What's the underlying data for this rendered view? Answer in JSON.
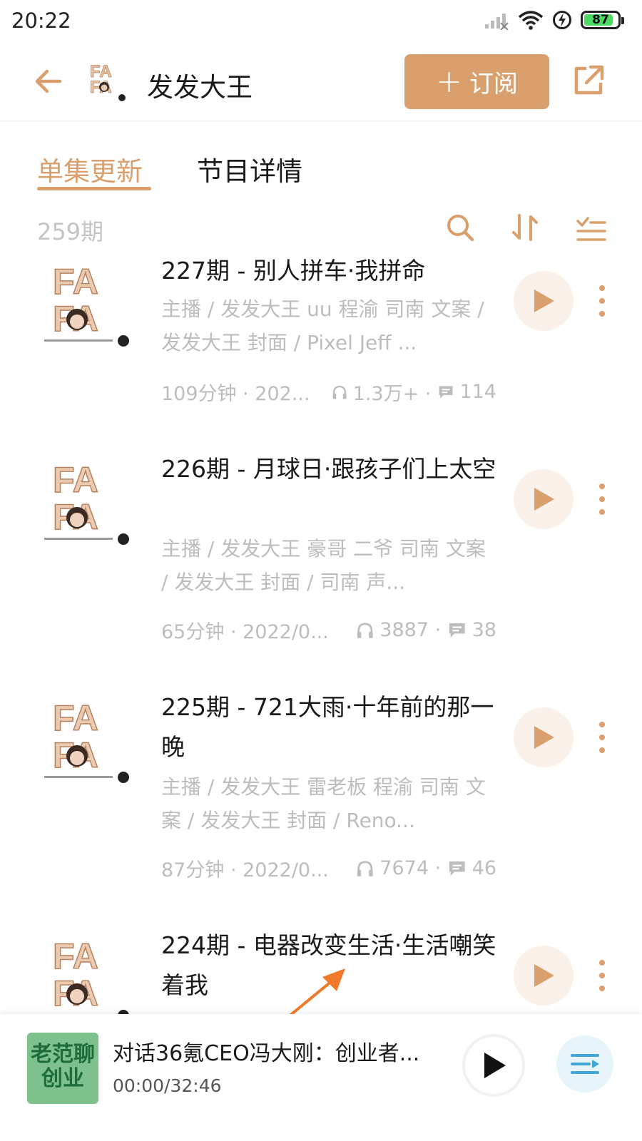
{
  "status_bar": {
    "time": "20:22",
    "battery": "87",
    "battery_level": 0.87
  },
  "header": {
    "podcast_title": "发发大王",
    "subscribe_label": "订阅",
    "icons": [
      "back-arrow-icon",
      "share-icon"
    ]
  },
  "tabs": {
    "active": "单集更新",
    "inactive": "节目详情"
  },
  "toolbar": {
    "episode_count": "259期",
    "icons": [
      "search-icon",
      "sort-icon",
      "filter-list-icon"
    ]
  },
  "episodes": [
    {
      "title": "227期 - 别人拼车·我拼命",
      "desc": "主播 / 发发大王 uu 程渝 司南 文案 / 发发大王 封面 / Pixel Jeff ...",
      "duration_date": "109分钟 · 202...",
      "plays": "1.3万+ ·",
      "comments": "114"
    },
    {
      "title": "226期 - 月球日·跟孩子们上太空",
      "desc": "主播 / 发发大王 豪哥 二爷 司南 文案 / 发发大王 封面 / 司南 声...",
      "duration_date": "65分钟 · 2022/0...",
      "plays": "3887 ·",
      "comments": "38"
    },
    {
      "title": "225期 - 721大雨·十年前的那一晚",
      "desc": "主播 / 发发大王 雷老板 程渝 司南 文案 / 发发大王 封面 / Reno...",
      "duration_date": "87分钟 · 2022/0...",
      "plays": "7674 ·",
      "comments": "46"
    },
    {
      "title": "224期 - 电器改变生活·生活嘲笑着我",
      "desc": "",
      "duration_date": "",
      "plays": "",
      "comments": ""
    }
  ],
  "mini_player": {
    "cover_text": "老范聊创业",
    "title": "对话36氪CEO冯大刚：创业者...",
    "time": "00:00/32:46"
  },
  "colors": {
    "accent": "#d9a06e",
    "muted_text": "#bdbdbd",
    "play_bg": "#faf1ea",
    "annotation_arrow": "#f07a2a"
  }
}
